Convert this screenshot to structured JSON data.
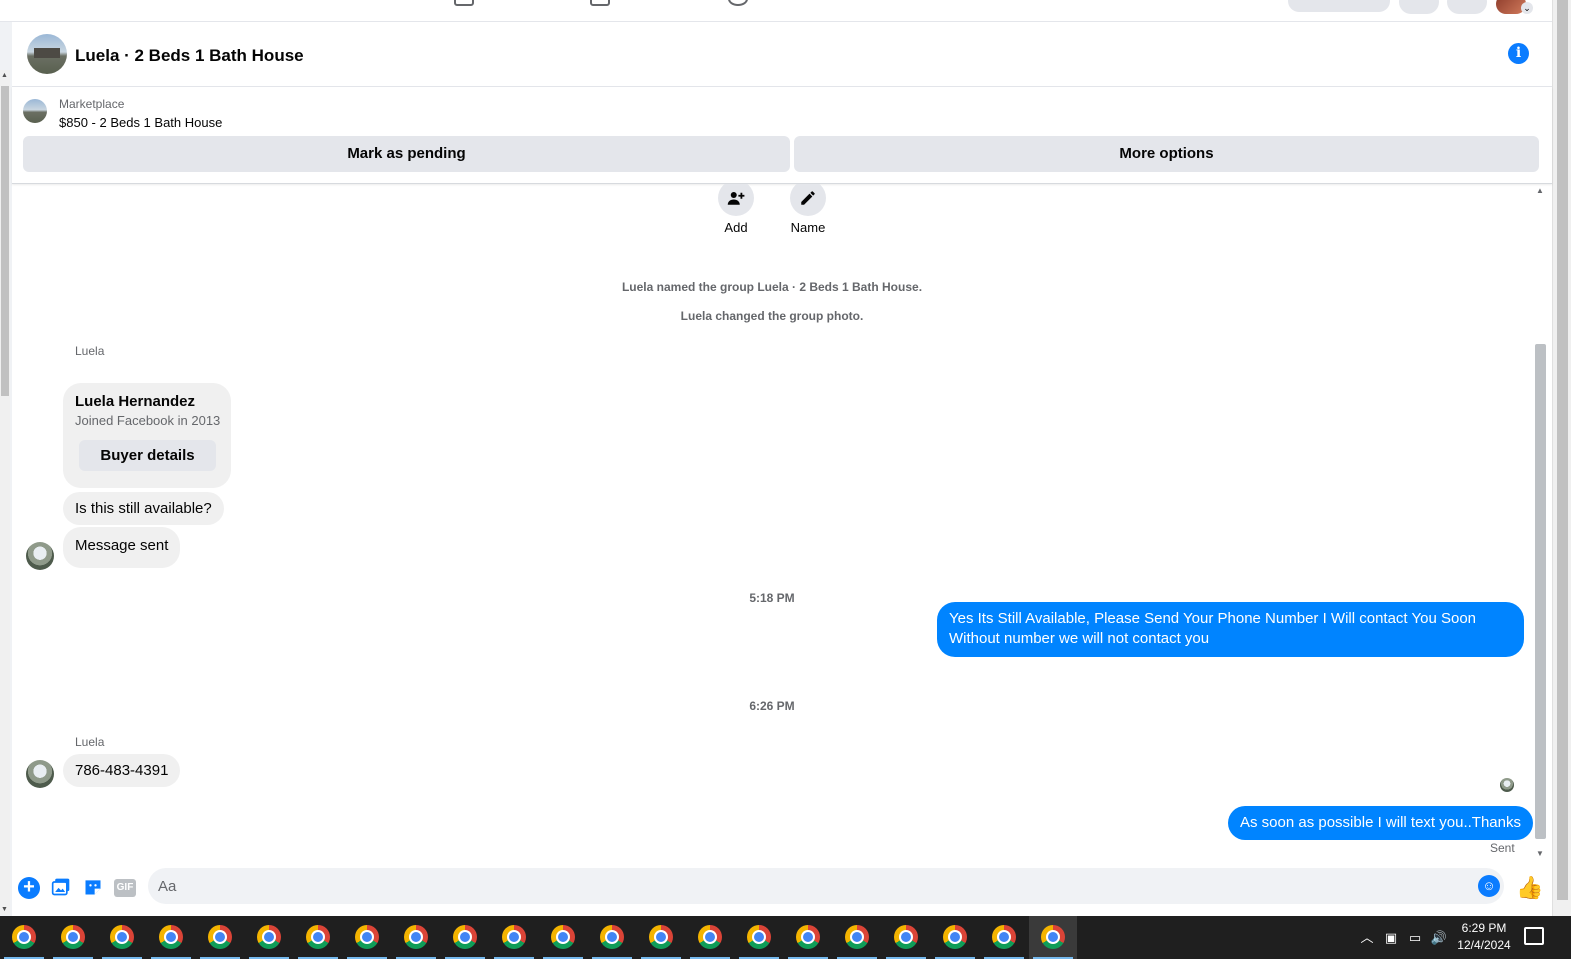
{
  "header": {
    "title": "Luela · 2 Beds 1 Bath House"
  },
  "listing": {
    "label": "Marketplace",
    "title": "$850 - 2 Beds 1 Bath House",
    "mark_pending_label": "Mark as pending",
    "more_options_label": "More options"
  },
  "actions": {
    "add_label": "Add",
    "name_label": "Name"
  },
  "system_messages": [
    "Luela named the group Luela · 2 Beds 1 Bath House.",
    "Luela changed the group photo."
  ],
  "buyer_card": {
    "sender": "Luela",
    "name": "Luela Hernandez",
    "joined": "Joined Facebook in 2013",
    "button_label": "Buyer details"
  },
  "messages": [
    {
      "direction": "incoming",
      "text": "Is this still available?"
    },
    {
      "direction": "incoming",
      "text": "Message sent"
    },
    {
      "direction": "timestamp",
      "text": "5:18 PM"
    },
    {
      "direction": "outgoing",
      "text": "Yes Its Still Available, Please Send Your Phone Number I Will contact  You Soon Without number we will not contact you"
    },
    {
      "direction": "timestamp",
      "text": "6:26 PM"
    },
    {
      "direction": "incoming",
      "sender": "Luela",
      "text": "786-483-4391"
    },
    {
      "direction": "outgoing",
      "text": "As soon as possible I will text you..Thanks"
    }
  ],
  "delivery_status": "Sent",
  "composer": {
    "placeholder": "Aa",
    "gif_label": "GIF",
    "value": ""
  },
  "taskbar": {
    "apps": [
      "chrome",
      "chrome",
      "chrome",
      "chrome",
      "chrome",
      "chrome",
      "chrome",
      "chrome",
      "chrome",
      "chrome",
      "chrome",
      "chrome",
      "chrome",
      "chrome",
      "chrome",
      "chrome",
      "chrome",
      "chrome",
      "chrome",
      "chrome",
      "chrome",
      "chrome"
    ],
    "active_index": 21,
    "time": "6:29 PM",
    "date": "12/4/2024"
  },
  "colors": {
    "accent": "#0084ff",
    "incoming_bubble": "#f0f0f0",
    "button_gray": "#e4e6eb",
    "taskbar": "#1f1f1f"
  },
  "icons": [
    "info-icon",
    "add-person-icon",
    "pencil-icon",
    "plus-icon",
    "photo-icon",
    "sticker-icon",
    "gif-icon",
    "emoji-icon",
    "thumbs-up-icon",
    "chrome-icon",
    "notification-icon"
  ]
}
